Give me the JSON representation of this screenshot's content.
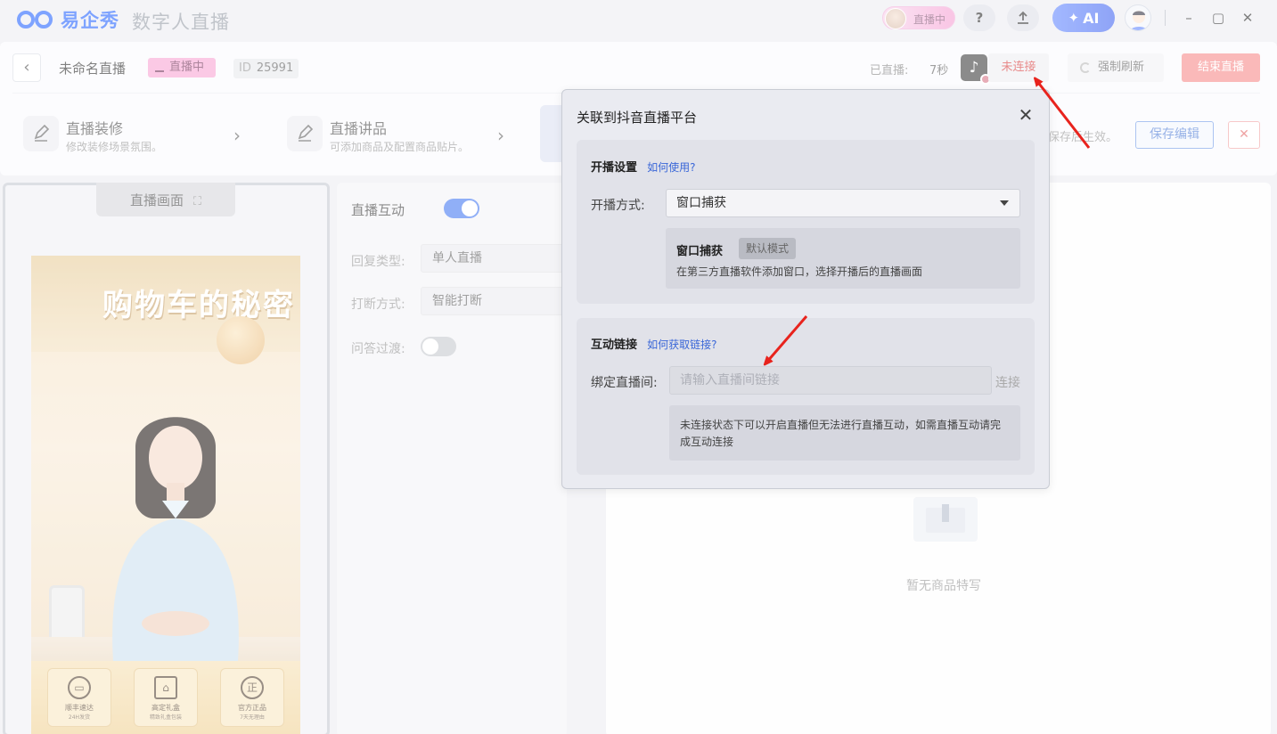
{
  "titlebar": {
    "logo_text": "易企秀",
    "app_title": "数字人直播",
    "live_pill_label": "直播中",
    "help_icon": "question-icon",
    "upload_icon": "upload-icon",
    "ai_label": "AI",
    "minimize": "–",
    "restore": "▢",
    "close": "✕"
  },
  "header": {
    "back_icon": "chevron-left-icon",
    "live_name": "未命名直播",
    "live_badge": "直播中",
    "id_label": "ID",
    "id_value": "25991",
    "elapsed_label": "已直播:",
    "elapsed_value": "7秒",
    "platform_icon": "tiktok-icon",
    "connection_status": "未连接",
    "refresh_label": "强制刷新",
    "end_label": "结束直播"
  },
  "steps": [
    {
      "title": "直播装修",
      "subtitle": "修改装修场景氛围。"
    },
    {
      "title": "直播讲品",
      "subtitle": "可添加商品及配置商品贴片。"
    }
  ],
  "save_hint": "保存后生效。",
  "save_button": "保存编辑",
  "close_edit": "✕",
  "preview": {
    "tab_label": "直播画面",
    "banner_text": "购物车的秘密",
    "badges": [
      {
        "icon": "truck-icon",
        "title": "顺丰速达",
        "sub": "24H发货"
      },
      {
        "icon": "gift-icon",
        "title": "高定礼盒",
        "sub": "精致礼盒包装"
      },
      {
        "icon": "genuine-icon",
        "glyph": "正",
        "title": "官方正品",
        "sub": "7天无理由"
      }
    ]
  },
  "interaction": {
    "label": "直播互动",
    "enabled": true,
    "reply_type_label": "回复类型:",
    "reply_type_value": "单人直播",
    "interrupt_label": "打断方式:",
    "interrupt_value": "智能打断",
    "qa_transition_label": "问答过渡:",
    "qa_transition_enabled": false
  },
  "products": {
    "empty_text": "暂无商品特写"
  },
  "modal": {
    "title": "关联到抖音直播平台",
    "broadcast_section": {
      "title": "开播设置",
      "help_link": "如何使用?",
      "method_label": "开播方式:",
      "method_value": "窗口捕获",
      "info_title": "窗口捕获",
      "info_tag": "默认模式",
      "info_desc": "在第三方直播软件添加窗口，选择开播后的直播画面"
    },
    "link_section": {
      "title": "互动链接",
      "help_link": "如何获取链接?",
      "bind_label": "绑定直播间:",
      "bind_placeholder": "请输入直播间链接",
      "connect_label": "连接",
      "notice": "未连接状态下可以开启直播但无法进行直播互动，如需直播互动请完成互动连接"
    }
  },
  "colors": {
    "accent_blue": "#4d7ff2",
    "live_pink": "#f8a9d6",
    "end_red": "#f78f8f",
    "annotation_red": "#e8231d"
  }
}
